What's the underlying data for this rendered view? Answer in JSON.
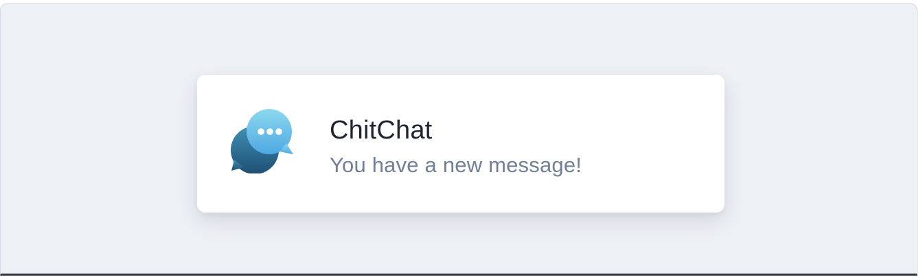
{
  "notification": {
    "app_name": "ChitChat",
    "message": "You have a new message!",
    "icon": "chat-bubbles-icon"
  },
  "colors": {
    "background": "#edf0f5",
    "card": "#ffffff",
    "title": "#1f2430",
    "message": "#718096",
    "bubble_back_top": "#3f8fb3",
    "bubble_back_bottom": "#1f4f74",
    "bubble_front_top": "#8bd8ee",
    "bubble_front_bottom": "#4fa8e2"
  }
}
